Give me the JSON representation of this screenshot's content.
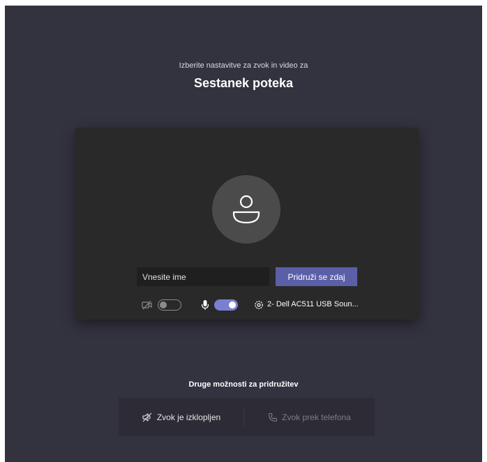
{
  "header": {
    "subtitle": "Izberite nastavitve za zvok in video za",
    "meeting_title": "Sestanek poteka"
  },
  "join_form": {
    "name_placeholder": "Vnesite ime",
    "name_value": "",
    "join_button_label": "Pridruži se zdaj"
  },
  "controls": {
    "camera": {
      "icon": "camera-off-icon",
      "enabled": false
    },
    "microphone": {
      "icon": "microphone-icon",
      "enabled": true
    },
    "device": {
      "icon": "gear-icon",
      "label": "2- Dell AC511 USB Soun..."
    }
  },
  "other_options": {
    "title": "Druge možnosti za pridružitev",
    "items": [
      {
        "icon": "speaker-off-icon",
        "label": "Zvok je izklopljen",
        "enabled": true
      },
      {
        "icon": "phone-icon",
        "label": "Zvok prek telefona",
        "enabled": false
      }
    ]
  },
  "colors": {
    "background": "#33323f",
    "preview": "#292929",
    "accent": "#5b5fa8",
    "toggle_on": "#7b7fd0"
  }
}
